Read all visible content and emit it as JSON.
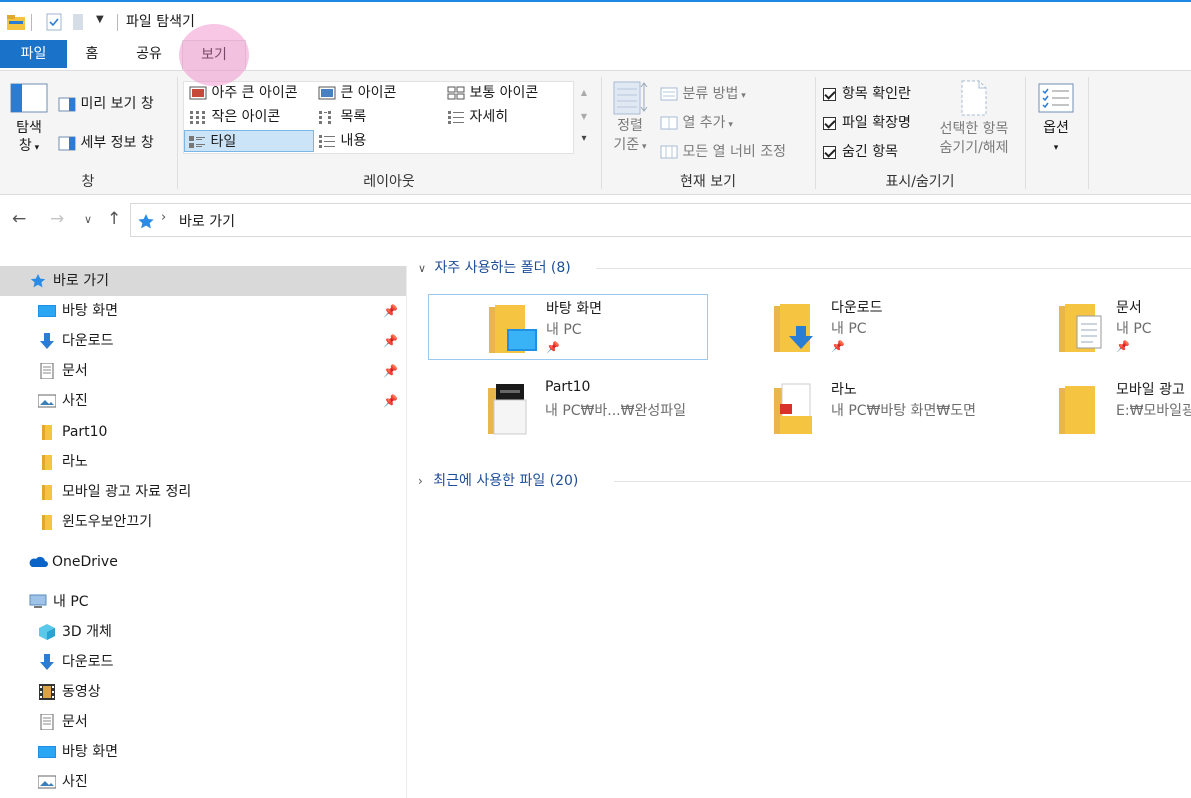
{
  "window": {
    "title": "파일 탐색기"
  },
  "tabs": [
    {
      "label": "파일"
    },
    {
      "label": "홈"
    },
    {
      "label": "공유"
    },
    {
      "label": "보기"
    }
  ],
  "ribbon": {
    "pane_group": {
      "label": "창",
      "nav_pane_label": "탐색",
      "nav_pane_label2": "창",
      "preview_label": "미리 보기 창",
      "details_label": "세부 정보 창"
    },
    "layout_group": {
      "label": "레이아웃",
      "items": [
        "아주 큰 아이콘",
        "큰 아이콘",
        "보통 아이콘",
        "작은 아이콘",
        "목록",
        "자세히",
        "타일",
        "내용"
      ]
    },
    "current_view_group": {
      "label": "현재 보기",
      "sort_label": "정렬",
      "sort_label2": "기준",
      "group_by_label": "분류 방법",
      "add_columns_label": "열 추가",
      "size_columns_label": "모든 열 너비 조정"
    },
    "show_hide_group": {
      "label": "표시/숨기기",
      "checkboxes": [
        "항목 확인란",
        "파일 확장명",
        "숨긴 항목"
      ],
      "hide_selected_label": "선택한 항목",
      "hide_selected_label2": "숨기기/해제"
    },
    "options": {
      "label": "옵션"
    }
  },
  "address": {
    "path": "바로 가기"
  },
  "navpane": {
    "quick_access": "바로 가기",
    "pinned": [
      "바탕 화면",
      "다운로드",
      "문서",
      "사진"
    ],
    "folders": [
      "Part10",
      "라노",
      "모바일 광고 자료 정리",
      "윈도우보안끄기"
    ],
    "onedrive": "OneDrive",
    "this_pc": "내 PC",
    "pc_items": [
      "3D 개체",
      "다운로드",
      "동영상",
      "문서",
      "바탕 화면",
      "사진"
    ]
  },
  "content": {
    "frequent_header": "자주 사용하는 폴더 (8)",
    "recent_header": "최근에 사용한 파일 (20)",
    "tiles": [
      {
        "name": "바탕 화면",
        "sub": "내 PC"
      },
      {
        "name": "다운로드",
        "sub": "내 PC"
      },
      {
        "name": "문서",
        "sub": "내 PC"
      },
      {
        "name": "Part10",
        "sub": "내 PC₩바...₩완성파일"
      },
      {
        "name": "라노",
        "sub": "내 PC₩바탕 화면₩도면"
      },
      {
        "name": "모바일 광고",
        "sub": "E:₩모바일광"
      }
    ]
  },
  "colors": {
    "accent": "#1a73c9",
    "folder": "#f5c542",
    "highlight": "#f082c8"
  }
}
